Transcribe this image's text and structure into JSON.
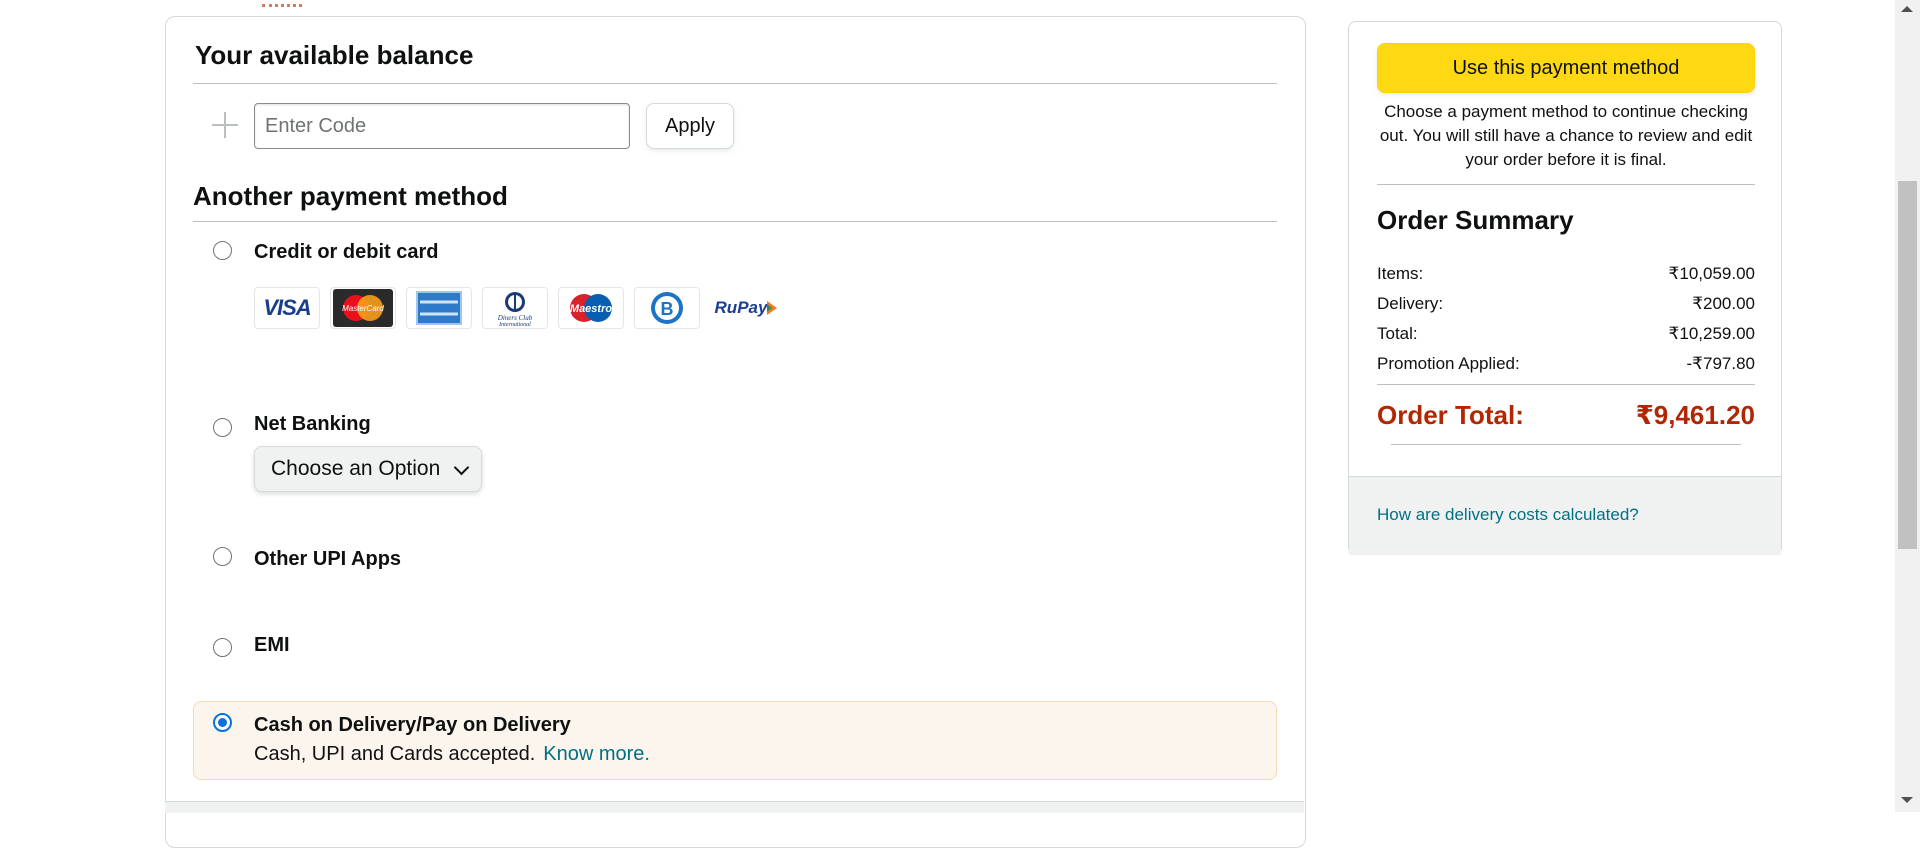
{
  "balance": {
    "title": "Your available balance",
    "code_placeholder": "Enter Code",
    "apply_label": "Apply"
  },
  "another": {
    "title": "Another payment method"
  },
  "options": {
    "card": {
      "label": "Credit or debit card",
      "checked": false
    },
    "netbanking": {
      "label": "Net Banking",
      "select_value": "Choose an Option",
      "checked": false
    },
    "upi": {
      "label": "Other UPI Apps",
      "checked": false
    },
    "emi": {
      "label": "EMI",
      "checked": false
    },
    "cod": {
      "label": "Cash on Delivery/Pay on Delivery",
      "sub": "Cash, UPI and Cards accepted.",
      "link": "Know more.",
      "checked": true
    }
  },
  "card_logos": {
    "visa": "VISA",
    "mastercard": "MasterCard",
    "amex": "AMERICAN EXPRESS",
    "diners": "Diners Club International",
    "maestro": "Maestro",
    "bajaj": "B",
    "rupay": "RuPay"
  },
  "icons": [
    "plus-icon",
    "chevron-down-icon",
    "visa-logo",
    "mastercard-logo",
    "amex-logo",
    "diners-club-logo",
    "maestro-logo",
    "bajaj-logo",
    "rupay-logo"
  ],
  "summary": {
    "cta": "Use this payment method",
    "note": "Choose a payment method to continue checking out. You will still have a chance to review and edit your order before it is final.",
    "title": "Order Summary",
    "rows": [
      {
        "label": "Items:",
        "value": "₹10,059.00"
      },
      {
        "label": "Delivery:",
        "value": "₹200.00"
      },
      {
        "label": "Total:",
        "value": "₹10,259.00"
      },
      {
        "label": "Promotion Applied:",
        "value": "-₹797.80"
      }
    ],
    "order_total_label": "Order Total:",
    "order_total_value": "₹9,461.20",
    "delivery_link": "How are delivery costs calculated?"
  },
  "colors": {
    "cta_yellow": "#ffd814",
    "order_total_red": "#b12704",
    "link_teal": "#007185",
    "radio_blue": "#0b6fdc",
    "cod_bg": "#fcf5ee"
  }
}
